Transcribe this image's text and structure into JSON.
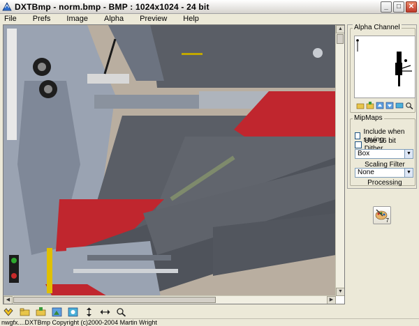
{
  "window": {
    "title": "DXTBmp - norm.bmp - BMP : 1024x1024 - 24 bit",
    "controls": {
      "minimize": "_",
      "maximize": "□",
      "close": "✕"
    }
  },
  "menu": {
    "items": [
      {
        "label": "File"
      },
      {
        "label": "Prefs"
      },
      {
        "label": "Image"
      },
      {
        "label": "Alpha"
      },
      {
        "label": "Preview"
      },
      {
        "label": "Help"
      }
    ]
  },
  "canvas": {
    "scroll_up": "▲",
    "scroll_down": "▼",
    "scroll_left": "◀",
    "scroll_right": "▶"
  },
  "alpha_channel": {
    "label": "Alpha Channel",
    "icons": [
      "open-folder-icon",
      "save-folder-icon",
      "import-icon",
      "export-icon",
      "view-icon",
      "zoom-icon"
    ]
  },
  "mipmaps": {
    "label": "MipMaps",
    "include_when_saving": "Include when saving",
    "include_checked": false,
    "use_16_bit": "Use 16 bit Dither",
    "use_16_checked": false,
    "filter_value": "Box",
    "scaling_filter_label": "Scaling Filter",
    "processing_value": "None",
    "processing_label": "Processing"
  },
  "process_button": {
    "badge": "7"
  },
  "toolbar": {
    "icons": [
      "grab-icon",
      "open-icon",
      "save-icon",
      "image-icon",
      "image-export-icon",
      "flip-vertical-icon",
      "flip-horizontal-icon",
      "zoom-icon"
    ]
  },
  "status": {
    "text": "nwgfx....DXTBmp Copyright (c)2000-2004 Martin Wright"
  },
  "colors": {
    "accent_red": "#c0262e",
    "panel_gray": "#5a5e66",
    "tan_background": "#b9aea0"
  }
}
